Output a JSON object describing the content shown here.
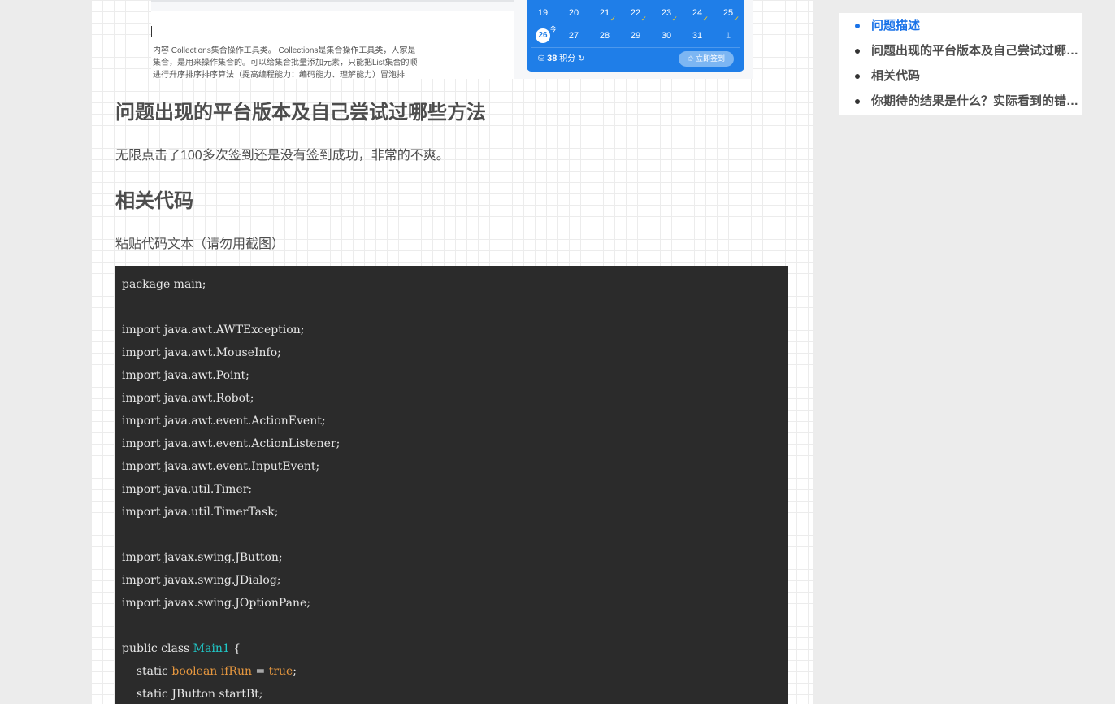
{
  "screenshot": {
    "doc_lines": [
      "内容 Collections集合操作工具类。 Collections是集合操作工具类，人家是",
      "集合，是用来操作集合的。可以给集合批量添加元素，只能把List集合的顺",
      "进行升序排序排序算法（提高编程能力：编码能力、理解能力）冒泡排"
    ],
    "calendar": {
      "row1": [
        {
          "day": "19",
          "check": ""
        },
        {
          "day": "20",
          "check": ""
        },
        {
          "day": "21",
          "check": "✓"
        },
        {
          "day": "22",
          "check": "✓"
        },
        {
          "day": "23",
          "check": "✓"
        },
        {
          "day": "24",
          "check": "✓"
        },
        {
          "day": "25",
          "check": "✓"
        }
      ],
      "today": "26",
      "today_tag": "今",
      "row2": [
        "27",
        "28",
        "29",
        "30",
        "31"
      ],
      "row2_dim": "1",
      "points_icon": "⛁",
      "points_value": "38",
      "points_label": "积分",
      "refresh_icon": "↻",
      "checkin_button": "✩ 立即签到"
    }
  },
  "sections": {
    "heading_platform": "问题出现的平台版本及自己尝试过哪些方法",
    "para_platform": "无限点击了100多次签到还是没有签到成功，非常的不爽。",
    "heading_code": "相关代码",
    "para_code": "粘贴代码文本（请勿用截图）"
  },
  "code": {
    "l1": "package main;",
    "l2": "import java.awt.AWTException;",
    "l3": "import java.awt.MouseInfo;",
    "l4": "import java.awt.Point;",
    "l5": "import java.awt.Robot;",
    "l6": "import java.awt.event.ActionEvent;",
    "l7": "import java.awt.event.ActionListener;",
    "l8": "import java.awt.event.InputEvent;",
    "l9": "import java.util.Timer;",
    "l10": "import java.util.TimerTask;",
    "l11": "import javax.swing.JButton;",
    "l12": "import javax.swing.JDialog;",
    "l13": "import javax.swing.JOptionPane;",
    "l14_pre": "public class ",
    "l14_cls": "Main1",
    "l14_post": " {",
    "l15_pre": "    static ",
    "l15_type": "boolean",
    "l15_sp": " ",
    "l15_var": "ifRun",
    "l15_eq": " = ",
    "l15_val": "true",
    "l15_end": ";",
    "l16": "    static JButton startBt;"
  },
  "toc": {
    "items": [
      {
        "label": "问题描述",
        "active": true
      },
      {
        "label": "问题出现的平台版本及自己尝试过哪些方法",
        "active": false
      },
      {
        "label": "相关代码",
        "active": false
      },
      {
        "label": "你期待的结果是什么？实际看到的错误信息又是什么？",
        "active": false
      }
    ]
  },
  "colors": {
    "accent": "#1a73e8",
    "calendar_bg": "#1f7ee8",
    "code_bg": "#2b2b2b",
    "code_keyword": "#e6973f",
    "code_class": "#20c7c7"
  }
}
